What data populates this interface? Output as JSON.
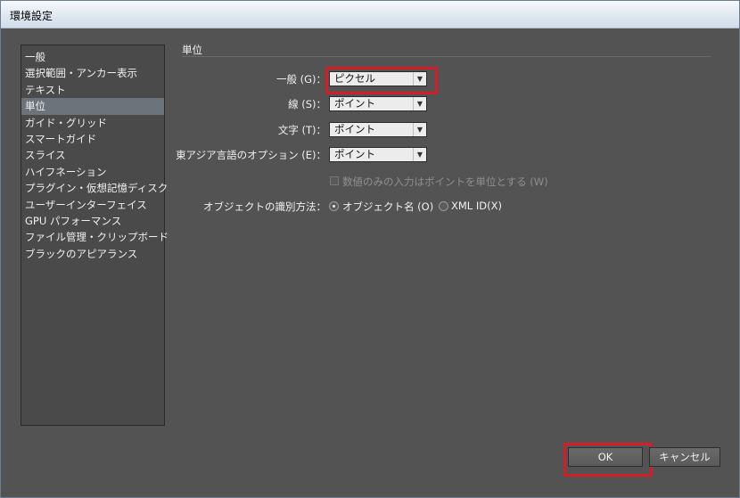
{
  "window": {
    "title": "環境設定"
  },
  "sidebar": {
    "items": [
      {
        "label": "一般"
      },
      {
        "label": "選択範囲・アンカー表示"
      },
      {
        "label": "テキスト"
      },
      {
        "label": "単位",
        "selected": true
      },
      {
        "label": "ガイド・グリッド"
      },
      {
        "label": "スマートガイド"
      },
      {
        "label": "スライス"
      },
      {
        "label": "ハイフネーション"
      },
      {
        "label": "プラグイン・仮想記憶ディスク"
      },
      {
        "label": "ユーザーインターフェイス"
      },
      {
        "label": "GPU パフォーマンス"
      },
      {
        "label": "ファイル管理・クリップボード"
      },
      {
        "label": "ブラックのアピアランス"
      }
    ]
  },
  "section": {
    "title": "単位"
  },
  "units": {
    "general": {
      "label": "一般 (G)：",
      "value": "ピクセル"
    },
    "stroke": {
      "label": "線 (S)：",
      "value": "ポイント"
    },
    "type": {
      "label": "文字 (T)：",
      "value": "ポイント"
    },
    "east_asian": {
      "label": "東アジア言語のオプション (E)：",
      "value": "ポイント"
    }
  },
  "numbers_only": {
    "label": "数値のみの入力はポイントを単位とする (W)",
    "checked": false,
    "disabled": true
  },
  "object_id": {
    "label": "オブジェクトの識別方法：",
    "options": [
      {
        "label": "オブジェクト名 (O)",
        "checked": true
      },
      {
        "label": "XML ID(X)",
        "checked": false
      }
    ]
  },
  "buttons": {
    "ok": "OK",
    "cancel": "キャンセル"
  },
  "colors": {
    "highlight": "#d31e27",
    "panel": "#535353",
    "selection": "#6d737b"
  }
}
